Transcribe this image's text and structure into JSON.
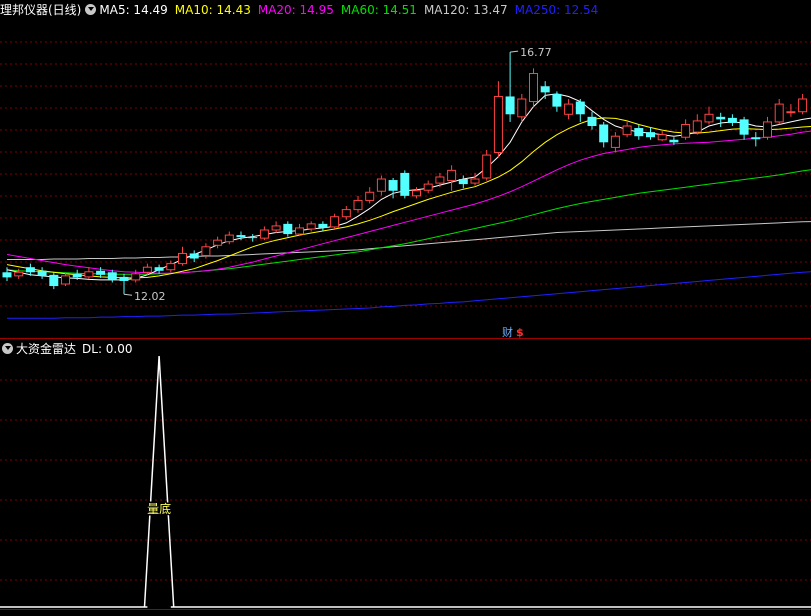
{
  "colors": {
    "background": "#000000",
    "up_candle": "#ff4444",
    "down_candle": "#54ffff",
    "ma5": "#ffffff",
    "ma10": "#ffff00",
    "ma20": "#ff00ff",
    "ma60": "#00e000",
    "ma120": "#c8c8c8",
    "ma250": "#2020ff",
    "indicator": "#ffffff",
    "grid": "#800000"
  },
  "main_panel": {
    "title": "理邦仪器(日线)",
    "ma_legend": [
      {
        "label": "MA5: 14.49",
        "color": "#ffffff"
      },
      {
        "label": "MA10: 14.43",
        "color": "#ffff00"
      },
      {
        "label": "MA20: 14.95",
        "color": "#ff00ff"
      },
      {
        "label": "MA60: 14.51",
        "color": "#00e000"
      },
      {
        "label": "MA120: 13.47",
        "color": "#c8c8c8"
      },
      {
        "label": "MA250: 12.54",
        "color": "#2020ff"
      }
    ],
    "high_label": "16.77",
    "low_label": "12.02",
    "finance_marker": "财",
    "dollar_marker": "$"
  },
  "indicator_panel": {
    "title": "大资金雷达",
    "value_label": "DL: 0.00",
    "annotation": "量底"
  },
  "chart_data": [
    {
      "type": "candlestick",
      "title": "理邦仪器(日线)",
      "ylim": [
        11.2,
        17.4
      ],
      "extremes": {
        "high": 16.77,
        "low": 12.02
      },
      "candles": [
        [
          12.45,
          12.35,
          12.55,
          12.28
        ],
        [
          12.38,
          12.45,
          12.52,
          12.32
        ],
        [
          12.55,
          12.45,
          12.62,
          12.38
        ],
        [
          12.48,
          12.38,
          12.55,
          12.32
        ],
        [
          12.4,
          12.18,
          12.45,
          12.12
        ],
        [
          12.22,
          12.38,
          12.45,
          12.18
        ],
        [
          12.42,
          12.35,
          12.5,
          12.3
        ],
        [
          12.36,
          12.46,
          12.55,
          12.32
        ],
        [
          12.48,
          12.4,
          12.55,
          12.34
        ],
        [
          12.45,
          12.3,
          12.5,
          12.25
        ],
        [
          12.36,
          12.28,
          12.42,
          12.02
        ],
        [
          12.3,
          12.42,
          12.5,
          12.25
        ],
        [
          12.45,
          12.55,
          12.62,
          12.4
        ],
        [
          12.55,
          12.48,
          12.6,
          12.42
        ],
        [
          12.5,
          12.62,
          12.68,
          12.45
        ],
        [
          12.62,
          12.82,
          12.95,
          12.58
        ],
        [
          12.82,
          12.72,
          12.88,
          12.65
        ],
        [
          12.78,
          12.95,
          13.02,
          12.72
        ],
        [
          12.98,
          13.08,
          13.15,
          12.92
        ],
        [
          13.05,
          13.18,
          13.25,
          13.0
        ],
        [
          13.18,
          13.14,
          13.25,
          13.08
        ],
        [
          13.14,
          13.12,
          13.2,
          13.05
        ],
        [
          13.12,
          13.28,
          13.35,
          13.08
        ],
        [
          13.28,
          13.36,
          13.45,
          13.22
        ],
        [
          13.4,
          13.2,
          13.45,
          13.15
        ],
        [
          13.2,
          13.32,
          13.4,
          13.16
        ],
        [
          13.3,
          13.4,
          13.45,
          13.25
        ],
        [
          13.4,
          13.32,
          13.45,
          13.25
        ],
        [
          13.34,
          13.54,
          13.6,
          13.3
        ],
        [
          13.54,
          13.68,
          13.75,
          13.48
        ],
        [
          13.68,
          13.86,
          13.95,
          13.62
        ],
        [
          13.86,
          14.02,
          14.12,
          13.8
        ],
        [
          14.04,
          14.28,
          14.35,
          13.96
        ],
        [
          14.26,
          14.05,
          14.3,
          13.9
        ],
        [
          14.4,
          13.95,
          14.45,
          13.9
        ],
        [
          13.95,
          14.05,
          14.12,
          13.9
        ],
        [
          14.06,
          14.18,
          14.25,
          14.0
        ],
        [
          14.2,
          14.32,
          14.4,
          14.12
        ],
        [
          14.25,
          14.45,
          14.55,
          14.05
        ],
        [
          14.28,
          14.18,
          14.35,
          14.1
        ],
        [
          14.2,
          14.28,
          14.4,
          14.15
        ],
        [
          14.3,
          14.75,
          14.85,
          14.25
        ],
        [
          14.8,
          15.9,
          16.2,
          14.7
        ],
        [
          15.9,
          15.55,
          16.77,
          15.4
        ],
        [
          15.5,
          15.85,
          15.95,
          15.4
        ],
        [
          15.8,
          16.35,
          16.45,
          15.7
        ],
        [
          16.1,
          15.98,
          16.2,
          15.85
        ],
        [
          15.95,
          15.7,
          16.0,
          15.6
        ],
        [
          15.55,
          15.75,
          15.85,
          15.45
        ],
        [
          15.8,
          15.55,
          15.85,
          15.4
        ],
        [
          15.5,
          15.32,
          15.6,
          15.25
        ],
        [
          15.35,
          15.0,
          15.4,
          14.9
        ],
        [
          14.9,
          15.12,
          15.2,
          14.8
        ],
        [
          15.15,
          15.32,
          15.4,
          15.1
        ],
        [
          15.28,
          15.12,
          15.35,
          15.05
        ],
        [
          15.2,
          15.1,
          15.3,
          15.05
        ],
        [
          15.05,
          15.15,
          15.22,
          15.02
        ],
        [
          15.05,
          15.0,
          15.1,
          14.95
        ],
        [
          15.1,
          15.35,
          15.45,
          15.05
        ],
        [
          15.2,
          15.42,
          15.55,
          15.15
        ],
        [
          15.4,
          15.55,
          15.7,
          15.35
        ],
        [
          15.5,
          15.45,
          15.58,
          15.3
        ],
        [
          15.48,
          15.38,
          15.55,
          15.32
        ],
        [
          15.45,
          15.15,
          15.5,
          15.05
        ],
        [
          15.1,
          15.06,
          15.2,
          14.92
        ],
        [
          15.1,
          15.4,
          15.5,
          15.05
        ],
        [
          15.4,
          15.75,
          15.85,
          15.35
        ],
        [
          15.6,
          15.6,
          15.75,
          15.5
        ],
        [
          15.6,
          15.85,
          15.95,
          15.55
        ]
      ],
      "series": [
        {
          "name": "MA5",
          "values": [
            12.5,
            12.45,
            12.4,
            12.38,
            12.36,
            12.34,
            12.33,
            12.31,
            12.3,
            12.3,
            12.3,
            12.33,
            12.4,
            12.5,
            12.6,
            12.7,
            12.8,
            12.89,
            12.99,
            13.07,
            13.12,
            13.15,
            13.19,
            13.23,
            13.25,
            13.27,
            13.3,
            13.32,
            13.35,
            13.42,
            13.55,
            13.7,
            13.88,
            14.0,
            14.05,
            14.07,
            14.1,
            14.16,
            14.22,
            14.28,
            14.32,
            14.5,
            14.72,
            15.0,
            15.4,
            15.7,
            15.92,
            15.95,
            15.9,
            15.8,
            15.62,
            15.45,
            15.32,
            15.25,
            15.2,
            15.18,
            15.15,
            15.12,
            15.15,
            15.2,
            15.32,
            15.38,
            15.4,
            15.38,
            15.32,
            15.3,
            15.35,
            15.4,
            15.45
          ]
        },
        {
          "name": "MA10",
          "values": [
            12.6,
            12.56,
            12.52,
            12.48,
            12.45,
            12.42,
            12.4,
            12.38,
            12.36,
            12.35,
            12.34,
            12.34,
            12.35,
            12.38,
            12.42,
            12.47,
            12.52,
            12.6,
            12.68,
            12.77,
            12.86,
            12.95,
            13.02,
            13.08,
            13.13,
            13.18,
            13.22,
            13.26,
            13.3,
            13.34,
            13.4,
            13.47,
            13.55,
            13.64,
            13.72,
            13.8,
            13.88,
            13.95,
            14.02,
            14.08,
            14.13,
            14.22,
            14.32,
            14.45,
            14.62,
            14.82,
            15.0,
            15.15,
            15.27,
            15.37,
            15.45,
            15.48,
            15.47,
            15.42,
            15.35,
            15.29,
            15.24,
            15.2,
            15.18,
            15.18,
            15.2,
            15.23,
            15.26,
            15.27,
            15.26,
            15.25,
            15.26,
            15.28,
            15.3
          ]
        },
        {
          "name": "MA20",
          "values": [
            12.8,
            12.76,
            12.72,
            12.68,
            12.64,
            12.6,
            12.57,
            12.54,
            12.51,
            12.48,
            12.46,
            12.45,
            12.44,
            12.43,
            12.43,
            12.44,
            12.46,
            12.48,
            12.51,
            12.55,
            12.6,
            12.65,
            12.71,
            12.77,
            12.83,
            12.89,
            12.95,
            13.01,
            13.07,
            13.13,
            13.19,
            13.25,
            13.31,
            13.37,
            13.43,
            13.49,
            13.55,
            13.61,
            13.67,
            13.73,
            13.79,
            13.86,
            13.94,
            14.03,
            14.13,
            14.24,
            14.35,
            14.46,
            14.56,
            14.65,
            14.72,
            14.78,
            14.82,
            14.86,
            14.9,
            14.93,
            14.95,
            14.97,
            14.98,
            14.99,
            15.0,
            15.02,
            15.04,
            15.06,
            15.08,
            15.1,
            15.13,
            15.16,
            15.2
          ]
        },
        {
          "name": "MA60",
          "values": [
            12.5,
            12.48,
            12.47,
            12.46,
            12.45,
            12.44,
            12.43,
            12.42,
            12.42,
            12.41,
            12.41,
            12.41,
            12.41,
            12.42,
            12.43,
            12.44,
            12.46,
            12.48,
            12.5,
            12.52,
            12.55,
            12.58,
            12.61,
            12.64,
            12.67,
            12.7,
            12.73,
            12.76,
            12.79,
            12.82,
            12.85,
            12.89,
            12.93,
            12.97,
            13.01,
            13.06,
            13.11,
            13.16,
            13.21,
            13.26,
            13.31,
            13.36,
            13.41,
            13.46,
            13.52,
            13.58,
            13.64,
            13.7,
            13.75,
            13.8,
            13.84,
            13.88,
            13.92,
            13.96,
            14.0,
            14.03,
            14.06,
            14.09,
            14.12,
            14.15,
            14.18,
            14.21,
            14.24,
            14.27,
            14.3,
            14.33,
            14.36,
            14.4,
            14.44
          ]
        },
        {
          "name": "MA120",
          "values": [
            12.7,
            12.7,
            12.7,
            12.7,
            12.71,
            12.71,
            12.71,
            12.72,
            12.72,
            12.72,
            12.73,
            12.73,
            12.74,
            12.74,
            12.75,
            12.75,
            12.76,
            12.77,
            12.77,
            12.78,
            12.79,
            12.8,
            12.81,
            12.82,
            12.83,
            12.84,
            12.85,
            12.86,
            12.87,
            12.88,
            12.89,
            12.91,
            12.93,
            12.95,
            12.97,
            12.99,
            13.01,
            13.03,
            13.05,
            13.07,
            13.09,
            13.11,
            13.13,
            13.15,
            13.17,
            13.19,
            13.21,
            13.23,
            13.24,
            13.25,
            13.26,
            13.27,
            13.28,
            13.29,
            13.3,
            13.31,
            13.32,
            13.33,
            13.34,
            13.35,
            13.36,
            13.37,
            13.38,
            13.39,
            13.4,
            13.41,
            13.42,
            13.43,
            13.44
          ]
        },
        {
          "name": "MA250",
          "values": [
            11.55,
            11.55,
            11.55,
            11.55,
            11.55,
            11.56,
            11.56,
            11.56,
            11.57,
            11.57,
            11.58,
            11.58,
            11.59,
            11.59,
            11.6,
            11.61,
            11.61,
            11.62,
            11.63,
            11.63,
            11.64,
            11.65,
            11.66,
            11.67,
            11.68,
            11.69,
            11.7,
            11.71,
            11.72,
            11.73,
            11.74,
            11.75,
            11.77,
            11.78,
            11.8,
            11.81,
            11.83,
            11.84,
            11.86,
            11.87,
            11.89,
            11.91,
            11.93,
            11.95,
            11.97,
            11.99,
            12.01,
            12.03,
            12.05,
            12.07,
            12.09,
            12.11,
            12.13,
            12.15,
            12.17,
            12.19,
            12.21,
            12.23,
            12.25,
            12.27,
            12.29,
            12.31,
            12.33,
            12.35,
            12.37,
            12.39,
            12.41,
            12.43,
            12.45
          ]
        }
      ]
    },
    {
      "type": "line",
      "title": "大资金雷达",
      "series": [
        {
          "name": "DL",
          "values": [
            0,
            0,
            0,
            0,
            0,
            0,
            0,
            0,
            0,
            0,
            0,
            0,
            0,
            100,
            0,
            0,
            0,
            0,
            0,
            0,
            0,
            0,
            0,
            0,
            0,
            0,
            0,
            0,
            0,
            0,
            0,
            0,
            0,
            0,
            0,
            0,
            0,
            0,
            0,
            0,
            0,
            0,
            0,
            0,
            0,
            0,
            0,
            0,
            0,
            0,
            0,
            0,
            0,
            0,
            0,
            0,
            0,
            0,
            0,
            0,
            0,
            0,
            0,
            0,
            0,
            0,
            0,
            0,
            0
          ]
        }
      ],
      "ylim": [
        0,
        100
      ],
      "annotation": {
        "index": 13,
        "text": "量底"
      }
    }
  ]
}
